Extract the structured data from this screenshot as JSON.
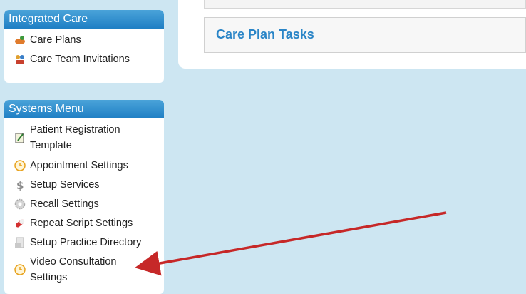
{
  "integrated_care": {
    "header": "Integrated Care",
    "items": [
      {
        "label": "Care Plans",
        "icon": "care-plans-icon"
      },
      {
        "label": "Care Team Invitations",
        "icon": "care-team-icon"
      }
    ]
  },
  "systems_menu": {
    "header": "Systems Menu",
    "items": [
      {
        "label": "Patient Registration Template",
        "icon": "registration-form-icon"
      },
      {
        "label": "Appointment Settings",
        "icon": "clock-icon"
      },
      {
        "label": "Setup Services",
        "icon": "dollar-icon"
      },
      {
        "label": "Recall Settings",
        "icon": "recall-gear-icon"
      },
      {
        "label": "Repeat Script Settings",
        "icon": "pill-icon"
      },
      {
        "label": "Setup Practice Directory",
        "icon": "directory-icon"
      },
      {
        "label": "Video Consultation Settings",
        "icon": "clock-icon"
      }
    ]
  },
  "main": {
    "section_title": "Care Plan Tasks"
  },
  "colors": {
    "background": "#cde6f2",
    "header_blue": "#1f7fc4",
    "title_blue": "#2a85c7",
    "annotation_arrow": "#c62828"
  }
}
